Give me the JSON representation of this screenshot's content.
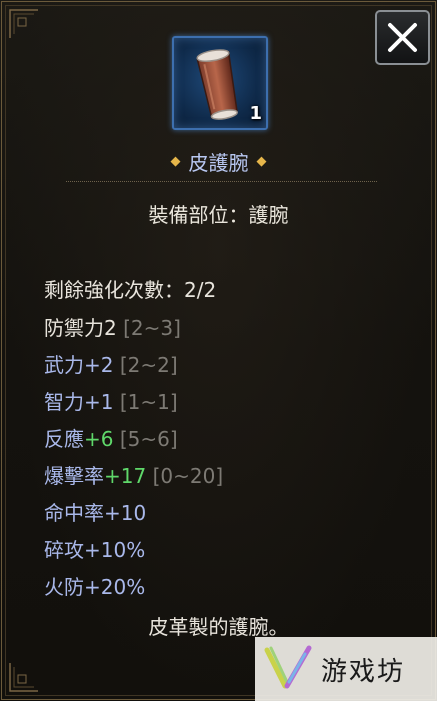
{
  "close_button": {
    "icon": "close-icon"
  },
  "item": {
    "icon": "bracer-icon",
    "count": "1",
    "name": "皮護腕",
    "name_color": "#b9c8f2",
    "equip_slot": "裝備部位：護腕",
    "description": "皮革製的護腕。"
  },
  "stats": {
    "enhance": {
      "label": "剩餘強化次數：2/2"
    },
    "defense": {
      "label": "防禦力2",
      "range": "[2~3]"
    },
    "martial": {
      "label": "武力+2",
      "range": "[2~2]"
    },
    "intellect": {
      "label": "智力+1",
      "range": "[1~1]"
    },
    "reflex": {
      "label": "反應",
      "bonus": "+6",
      "range": "[5~6]"
    },
    "crit": {
      "label": "爆擊率",
      "bonus": "+17",
      "range": "[0~20]"
    },
    "accuracy": {
      "label": "命中率+10"
    },
    "pierce": {
      "label": "碎攻+10%"
    },
    "fire_res": {
      "label": "火防+20%"
    }
  },
  "colors": {
    "white_text": "#e8e4dc",
    "blue_text": "#a9b8ea",
    "green_bonus": "#5fd86a",
    "gray_range": "#7d7a74",
    "gold_frame": "#6b5a3b",
    "icon_border": "#3d6fae"
  },
  "watermark": {
    "text": "游戏坊"
  }
}
